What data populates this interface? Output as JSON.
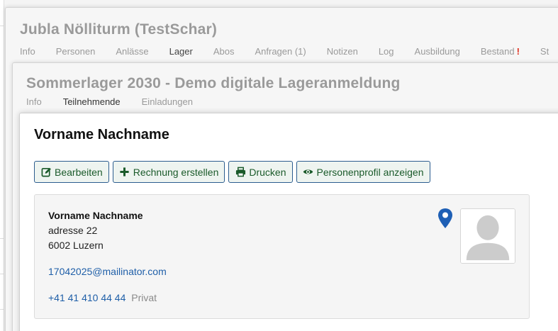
{
  "group": {
    "title": "Jubla Nölliturm (TestSchar)",
    "tabs": [
      {
        "label": "Info"
      },
      {
        "label": "Personen"
      },
      {
        "label": "Anlässe"
      },
      {
        "label": "Lager",
        "active": true
      },
      {
        "label": "Abos"
      },
      {
        "label": "Anfragen (1)"
      },
      {
        "label": "Notizen"
      },
      {
        "label": "Log"
      },
      {
        "label": "Ausbildung"
      },
      {
        "label": "Bestand",
        "warning": "!"
      },
      {
        "label": "St"
      }
    ]
  },
  "event": {
    "title": "Sommerlager 2030 - Demo digitale Lageranmeldung",
    "tabs": [
      {
        "label": "Info"
      },
      {
        "label": "Teilnehmende",
        "active": true
      },
      {
        "label": "Einladungen"
      }
    ]
  },
  "person": {
    "title": "Vorname Nachname",
    "buttons": {
      "edit": "Bearbeiten",
      "invoice": "Rechnung erstellen",
      "print": "Drucken",
      "profile": "Personenprofil anzeigen"
    },
    "card": {
      "name": "Vorname Nachname",
      "address_line1": "adresse 22",
      "address_line2": "6002 Luzern",
      "email": "17042025@mailinator.com",
      "phone": "+41 41 410 44 44",
      "phone_label": "Privat"
    }
  },
  "icons": {
    "edit": "edit-icon",
    "invoice": "plus-icon",
    "print": "print-icon",
    "profile": "eye-icon",
    "map": "map-pin-icon",
    "avatar": "avatar-placeholder-icon"
  },
  "colors": {
    "button_text": "#1a5a2a",
    "button_border": "#2c5d8f",
    "link": "#1f5fa8",
    "map_pin": "#1e5fb5",
    "warning": "#e0301e",
    "muted_title": "#9a9a9a"
  }
}
